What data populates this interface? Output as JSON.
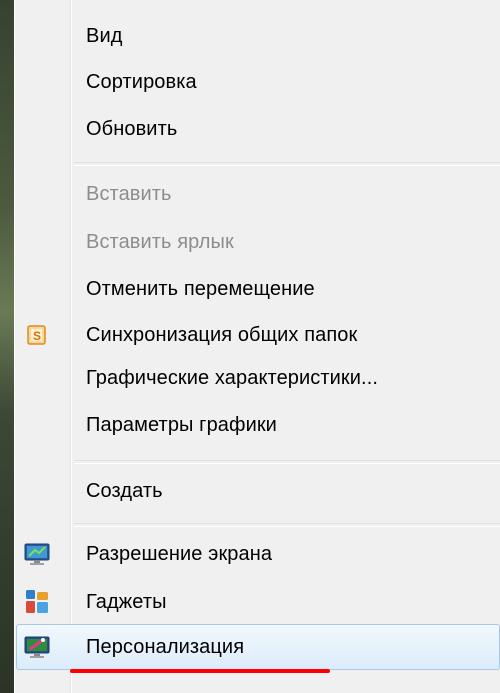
{
  "menu": {
    "view": "Вид",
    "sort": "Сортировка",
    "refresh": "Обновить",
    "paste": "Вставить",
    "paste_shortcut": "Вставить ярлык",
    "undo_move": "Отменить перемещение",
    "sync_shared_folders": "Синхронизация общих папок",
    "graphics_properties": "Графические характеристики...",
    "graphics_options": "Параметры графики",
    "new": "Создать",
    "screen_resolution": "Разрешение экрана",
    "gadgets": "Гаджеты",
    "personalize": "Персонализация"
  },
  "icons": {
    "sync": "sync-icon",
    "screen_resolution": "display-icon",
    "gadgets": "gadgets-icon",
    "personalize": "personalize-icon"
  },
  "colors": {
    "menu_background": "#f0f0f0",
    "disabled_text": "#8d8d8d",
    "hover_border": "#a8c8e8",
    "annotation_underline": "#ff0000"
  }
}
